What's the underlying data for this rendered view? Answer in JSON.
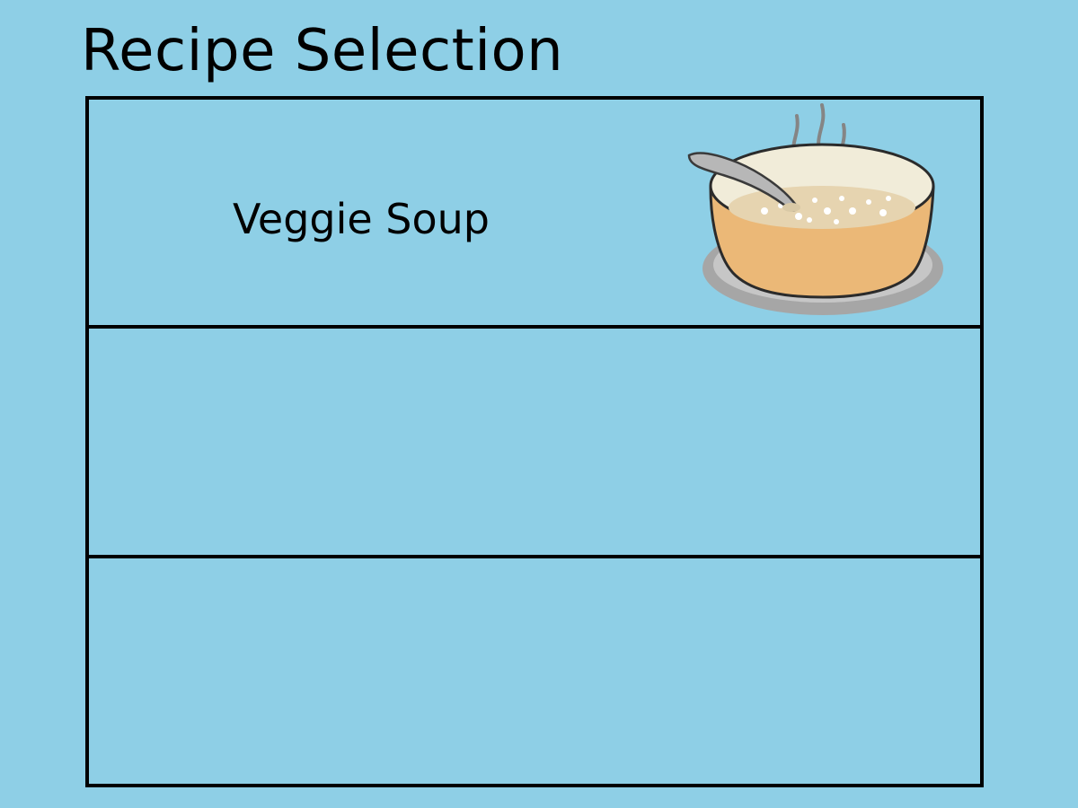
{
  "page": {
    "title": "Recipe Selection",
    "background_color": "#8ecfe6"
  },
  "recipes": [
    {
      "name": "Veggie Soup",
      "image_icon": "soup-bowl-icon"
    },
    {
      "name": "",
      "image_icon": ""
    },
    {
      "name": "",
      "image_icon": ""
    }
  ]
}
